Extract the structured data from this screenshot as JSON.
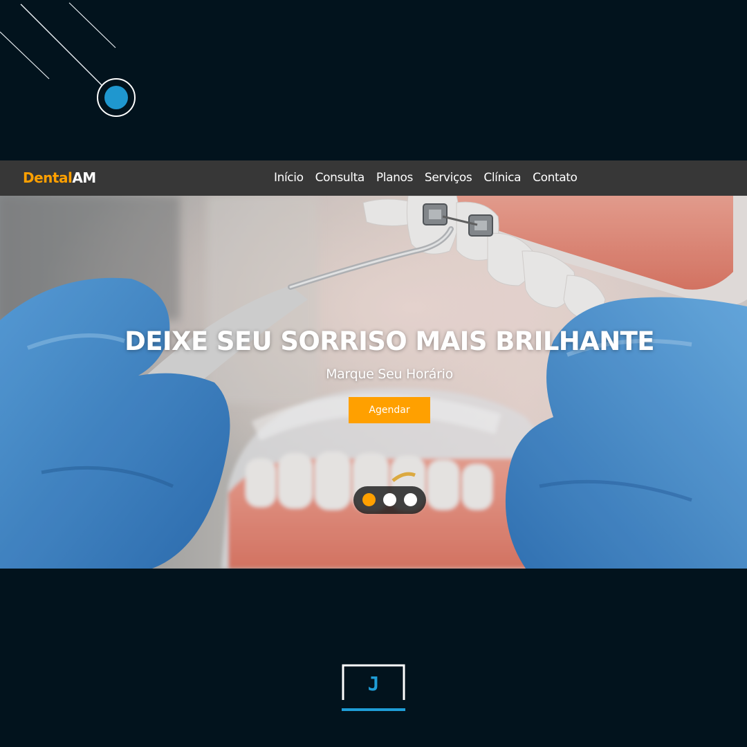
{
  "brand": {
    "part1": "Dental",
    "part2": "AM"
  },
  "nav": {
    "items": [
      "Início",
      "Consulta",
      "Planos",
      "Serviços",
      "Clínica",
      "Contato"
    ]
  },
  "hero": {
    "title": "DEIXE SEU SORRISO MAIS BRILHANTE",
    "subtitle": "Marque Seu Horário",
    "cta_label": "Agendar",
    "carousel": {
      "slides": 3,
      "active": 1
    }
  },
  "footer_logo": {
    "letter": "J"
  },
  "colors": {
    "background": "#02131d",
    "navbar": "#373737",
    "accent": "#ffa000",
    "logo_blue": "#1f9dd6"
  }
}
